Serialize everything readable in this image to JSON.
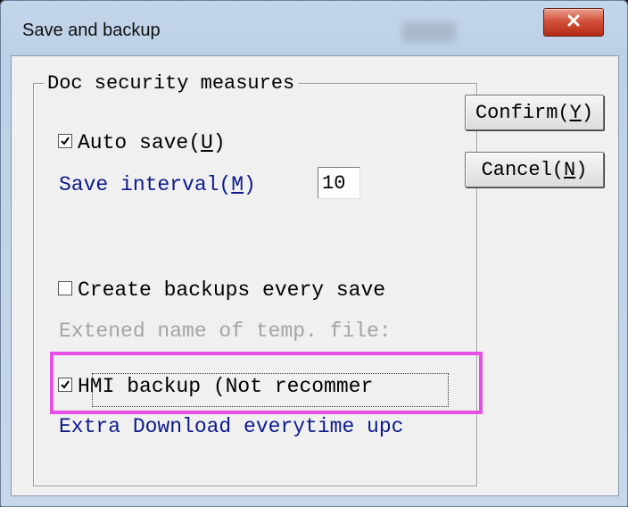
{
  "window": {
    "title": "Save and backup",
    "close_icon": "x-icon"
  },
  "group": {
    "title": "Doc security measures"
  },
  "auto_save": {
    "label": "Auto save(",
    "hotkey": "U",
    "suffix": ")",
    "checked": true
  },
  "save_interval": {
    "label": "Save interval(",
    "hotkey": "M",
    "suffix": ")",
    "value": "10"
  },
  "create_backups": {
    "label": "Create backups every save",
    "checked": false
  },
  "temp_file": {
    "label": "Extened name of temp. file:"
  },
  "hmi_backup": {
    "label": "HMI backup (Not recommer",
    "checked": true
  },
  "extra_download": {
    "label": "Extra Download everytime upc"
  },
  "buttons": {
    "confirm": {
      "label": "Confirm(",
      "hotkey": "Y",
      "suffix": ")"
    },
    "cancel": {
      "label": "Cancel(",
      "hotkey": "N",
      "suffix": ")"
    }
  },
  "colors": {
    "highlight": "#e64fe6",
    "blue_text": "#0d1a8c",
    "disabled_text": "#a4a4a4",
    "close_button": "#c8432c"
  }
}
